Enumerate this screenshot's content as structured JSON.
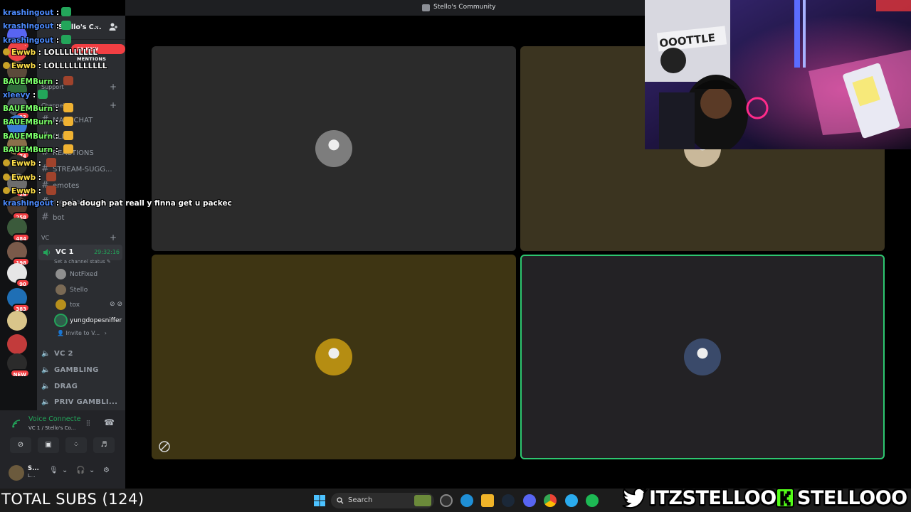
{
  "window": {
    "title": "Stello's Community"
  },
  "server": {
    "name": "Stello's C...",
    "mentions_badge": "29 NEW MENTIONS"
  },
  "rail": {
    "items": [
      {
        "badge": "64",
        "color": "#5865f2"
      },
      {
        "badge": "",
        "color": "#ed4245"
      },
      {
        "badge": "",
        "color": "#5b4a3a"
      },
      {
        "badge": "",
        "color": "#2e6b3a"
      },
      {
        "badge": "22",
        "color": "#4a4f57"
      },
      {
        "badge": "",
        "color": "#3a7bd5"
      },
      {
        "badge": "74",
        "color": "#8a6f4a"
      },
      {
        "badge": "",
        "color": "#2b2b2b"
      },
      {
        "badge": "29",
        "color": "#6d6d6d"
      },
      {
        "badge": "258",
        "color": "#4c3b2f"
      },
      {
        "badge": "484",
        "color": "#3b5a3b"
      },
      {
        "badge": "198",
        "color": "#7a5a4a"
      },
      {
        "badge": "90",
        "color": "#e6e6e6"
      },
      {
        "badge": "383",
        "color": "#1f6fb5"
      },
      {
        "badge": "",
        "color": "#d9c58a"
      },
      {
        "badge": "",
        "color": "#c23b3b"
      },
      {
        "badge": "NEW",
        "color": "#2b2b2b"
      }
    ]
  },
  "channels": {
    "categories": [
      {
        "label": "Support"
      },
      {
        "label": "Channels"
      },
      {
        "label": "VC"
      }
    ],
    "text": [
      "MAIN-CHAT",
      "CLIPS",
      "REACTIONS",
      "STREAM-SUGG...",
      "emotes",
      "rage-bait",
      "bot"
    ],
    "voice": [
      "VC 2",
      "GAMBLING",
      "DRAG",
      "PRIV GAMBLI..."
    ]
  },
  "active_vc": {
    "name": "VC 1",
    "timer": "29:32:16",
    "status_placeholder": "Set a channel status",
    "members": [
      {
        "name": "NotFixed",
        "speaking": false
      },
      {
        "name": "Stello",
        "speaking": false
      },
      {
        "name": "tox",
        "speaking": false
      },
      {
        "name": "yungdopesniffer",
        "speaking": true
      }
    ],
    "invite_label": "Invite to V..."
  },
  "voice_panel": {
    "title": "Voice Connecte",
    "subtitle": "VC 1 / Stello's Co..."
  },
  "user_panel": {
    "name": "S...",
    "status": "L..."
  },
  "tiles": [
    {
      "bg": "#2b2b2b",
      "avatar": "#7d7d7d",
      "speaking": false,
      "cam_off": false
    },
    {
      "bg": "#3b3420",
      "avatar": "#c9b89a",
      "speaking": false,
      "cam_off": false
    },
    {
      "bg": "#3e3513",
      "avatar": "#b58d12",
      "speaking": false,
      "cam_off": true
    },
    {
      "bg": "#232225",
      "avatar": "#3a4a6a",
      "speaking": true,
      "cam_off": false
    }
  ],
  "chat": {
    "messages": [
      {
        "user": "krashingout",
        "sep": " :",
        "text": "",
        "color": "#4d8cff",
        "dot": "",
        "emote": "#23a55a"
      },
      {
        "user": "krashingout",
        "sep": " :",
        "text": "",
        "color": "#4d8cff",
        "dot": "",
        "emote": "#23a55a"
      },
      {
        "user": "krashingout",
        "sep": " :",
        "text": "",
        "color": "#4d8cff",
        "dot": "",
        "emote": "#23a55a"
      },
      {
        "user": "Ewwb",
        "sep": " : ",
        "text": "LOLLLLLLLLL",
        "color": "#ffe04a",
        "dot": "#c9a227",
        "emote": ""
      },
      {
        "user": "Ewwb",
        "sep": " : ",
        "text": "LOLLLLLLLLLLL",
        "color": "#ffe04a",
        "dot": "#c9a227",
        "emote": ""
      },
      {
        "user": "BAUEMBurn",
        "sep": " : ",
        "text": "",
        "color": "#7cff6b",
        "dot": "",
        "emote": "#a0432c"
      },
      {
        "user": "xleevy",
        "sep": " :",
        "text": "",
        "color": "#4d8cff",
        "dot": "",
        "emote": "#23a55a"
      },
      {
        "user": "BAUEMBurn",
        "sep": " : ",
        "text": "",
        "color": "#7cff6b",
        "dot": "",
        "emote": "#f0b232"
      },
      {
        "user": "BAUEMBurn",
        "sep": " : ",
        "text": "",
        "color": "#7cff6b",
        "dot": "",
        "emote": "#f0b232"
      },
      {
        "user": "BAUEMBurn",
        "sep": " : ",
        "text": "",
        "color": "#7cff6b",
        "dot": "",
        "emote": "#f0b232"
      },
      {
        "user": "BAUEMBurn",
        "sep": " : ",
        "text": "",
        "color": "#7cff6b",
        "dot": "",
        "emote": "#f0b232"
      },
      {
        "user": "Ewwb",
        "sep": " : ",
        "text": "",
        "color": "#ffe04a",
        "dot": "#c9a227",
        "emote": "#a0432c"
      },
      {
        "user": "Ewwb",
        "sep": " : ",
        "text": "",
        "color": "#ffe04a",
        "dot": "#c9a227",
        "emote": "#a0432c"
      },
      {
        "user": "Ewwb",
        "sep": " : ",
        "text": "",
        "color": "#ffe04a",
        "dot": "#c9a227",
        "emote": "#a0432c"
      },
      {
        "user": "krashingout",
        "sep": " : ",
        "text": "pea dough pat reall y finna get u packec",
        "color": "#4d8cff",
        "dot": "",
        "emote": ""
      }
    ]
  },
  "overlay": {
    "subs": "TOTAL SUBS (124)",
    "twitter_handle": "ITZSTELLOO",
    "kick_handle": "STELLOOO"
  },
  "taskbar": {
    "search_label": "Search"
  },
  "colors": {
    "accent_green": "#23a55a",
    "mention_red": "#f23f43",
    "blurple": "#5865f2"
  }
}
